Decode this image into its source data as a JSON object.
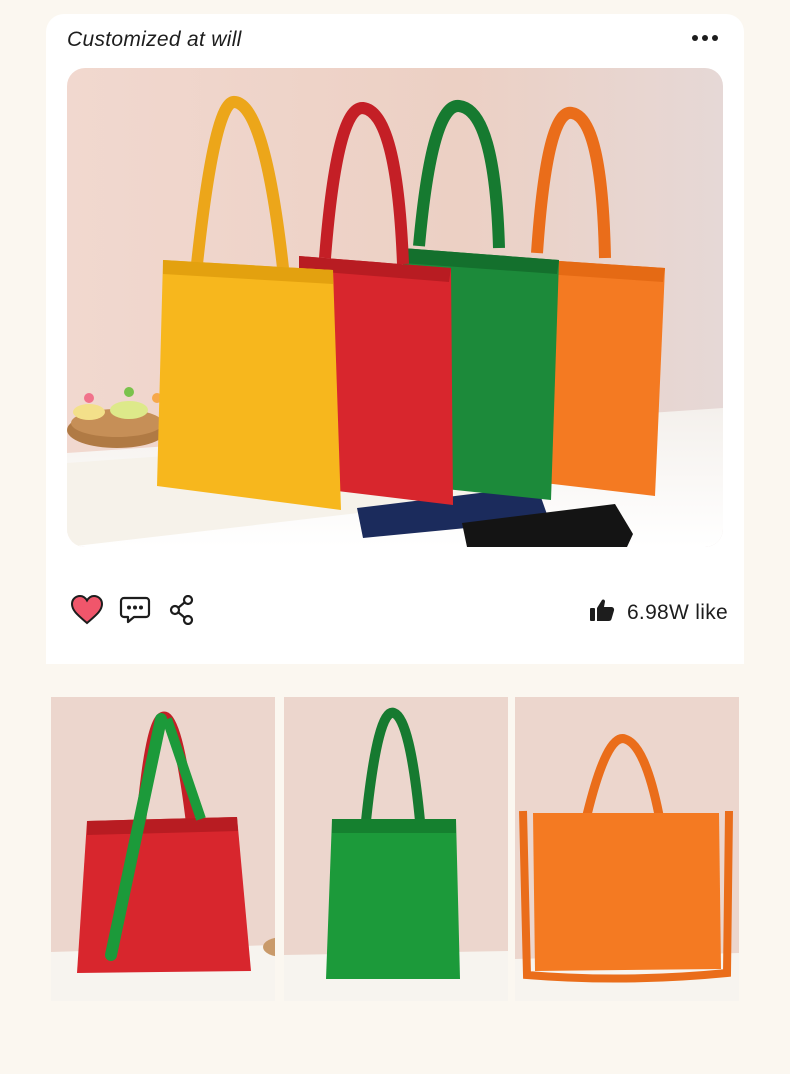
{
  "post": {
    "title": "Customized at will",
    "more_icon": "more-horizontal-icon",
    "hero_image": "photo of six colored canvas tote bags (yellow, red, green, orange, navy, black) on a table",
    "actions": {
      "like_icon": "heart-icon",
      "comment_icon": "comment-icon",
      "share_icon": "share-icon"
    },
    "likes": {
      "icon": "thumbs-up-icon",
      "text": "6.98W like"
    }
  },
  "gallery": [
    {
      "image": "red tote bag with green strap",
      "color": "#d8262d"
    },
    {
      "image": "green tote bag",
      "color": "#1c9a3a"
    },
    {
      "image": "orange tote bag with shoulder strap",
      "color": "#f47a22"
    }
  ],
  "colors": {
    "background": "#fbf7f0",
    "card": "#ffffff",
    "heart": "#f0566b",
    "yellow": "#f7b71d",
    "red": "#d8262d",
    "green": "#1c8a3a",
    "orange": "#f47a22",
    "navy": "#1b2b5c",
    "black": "#141414"
  }
}
